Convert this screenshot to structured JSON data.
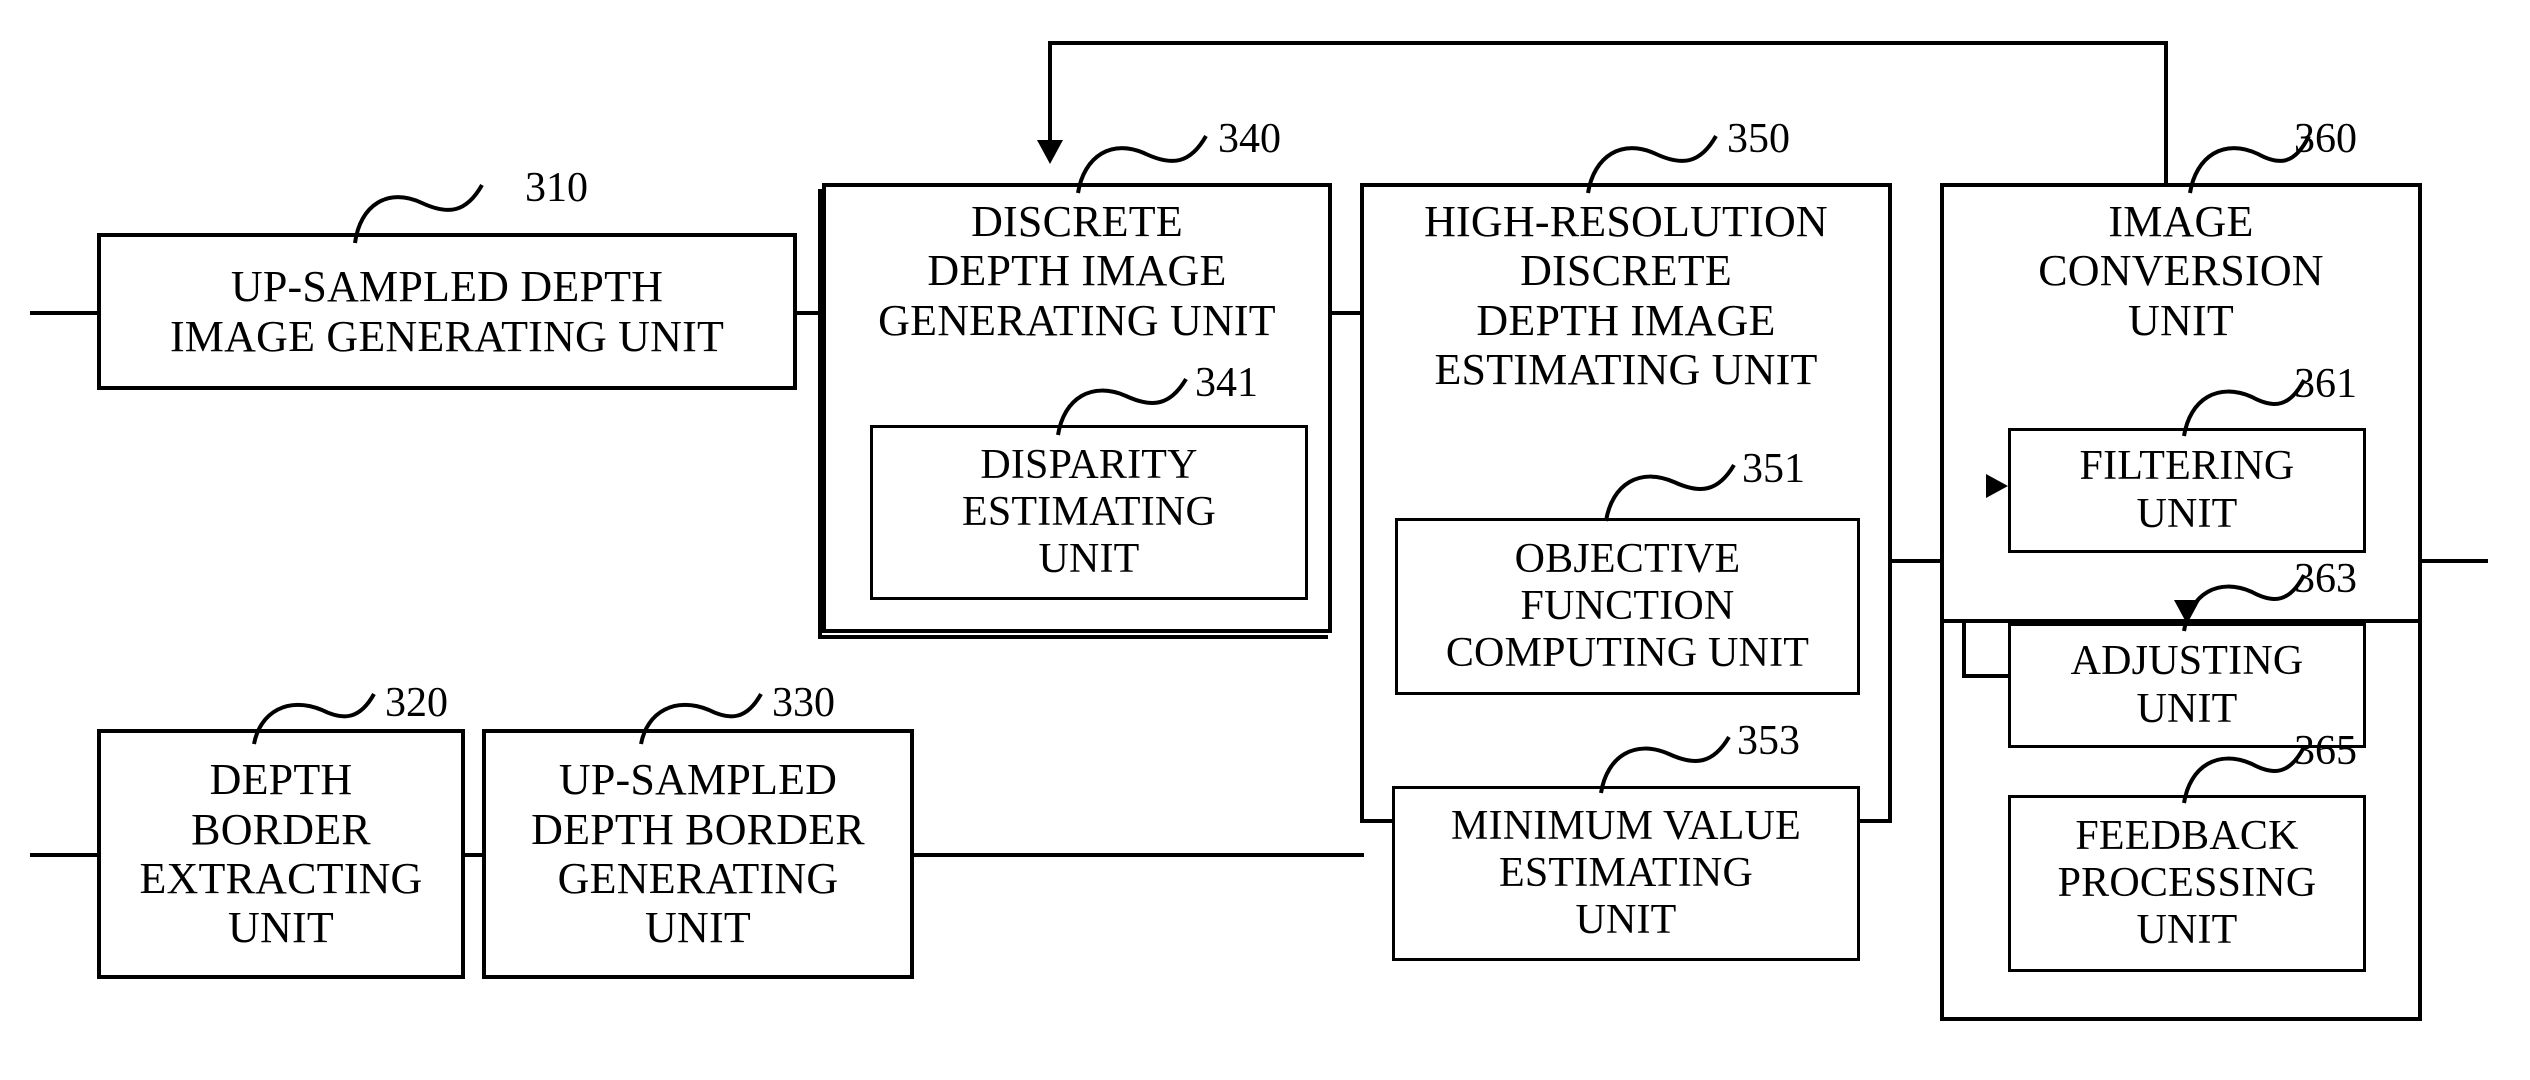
{
  "figure": {
    "type": "patent-block-diagram",
    "background": "#ffffff",
    "line_color": "#000000"
  },
  "blocks": {
    "b310": {
      "ref": "310",
      "label": "UP-SAMPLED DEPTH\nIMAGE GENERATING UNIT"
    },
    "b320": {
      "ref": "320",
      "label": "DEPTH\nBORDER\nEXTRACTING\nUNIT"
    },
    "b330": {
      "ref": "330",
      "label": "UP-SAMPLED\nDEPTH BORDER\nGENERATING\nUNIT"
    },
    "b340": {
      "ref": "340",
      "label": "DISCRETE\nDEPTH IMAGE\nGENERATING UNIT"
    },
    "b341": {
      "ref": "341",
      "label": "DISPARITY\nESTIMATING\nUNIT"
    },
    "b350": {
      "ref": "350",
      "label": "HIGH-RESOLUTION\nDISCRETE\nDEPTH IMAGE\nESTIMATING UNIT"
    },
    "b351": {
      "ref": "351",
      "label": "OBJECTIVE\nFUNCTION\nCOMPUTING UNIT"
    },
    "b353": {
      "ref": "353",
      "label": "MINIMUM VALUE\nESTIMATING\nUNIT"
    },
    "b360": {
      "ref": "360",
      "label": "IMAGE\nCONVERSION\nUNIT"
    },
    "b361": {
      "ref": "361",
      "label": "FILTERING\nUNIT"
    },
    "b363": {
      "ref": "363",
      "label": "ADJUSTING\nUNIT"
    },
    "b365": {
      "ref": "365",
      "label": "FEEDBACK\nPROCESSING\nUNIT"
    }
  },
  "connections": [
    {
      "name": "input-to-310",
      "from": "external-input",
      "to": "b310"
    },
    {
      "name": "310-to-340",
      "from": "b310",
      "to": "b340"
    },
    {
      "name": "340-to-350",
      "from": "b340",
      "to": "b350"
    },
    {
      "name": "350-to-360",
      "from": "b350",
      "to": "b360"
    },
    {
      "name": "360-output",
      "from": "b360",
      "to": "external-output"
    },
    {
      "name": "input-to-320",
      "from": "external-input",
      "to": "b320"
    },
    {
      "name": "320-to-330",
      "from": "b320",
      "to": "b330"
    },
    {
      "name": "330-to-350",
      "from": "b330",
      "to": "b350"
    },
    {
      "name": "360-feedback-to-340",
      "from": "b360",
      "to": "b340",
      "arrow": "down"
    },
    {
      "name": "361-to-363",
      "from": "b361",
      "to": "b363",
      "arrow": "down"
    },
    {
      "name": "363-feedback-to-361",
      "from": "b363",
      "to": "b361",
      "arrow": "right"
    }
  ]
}
